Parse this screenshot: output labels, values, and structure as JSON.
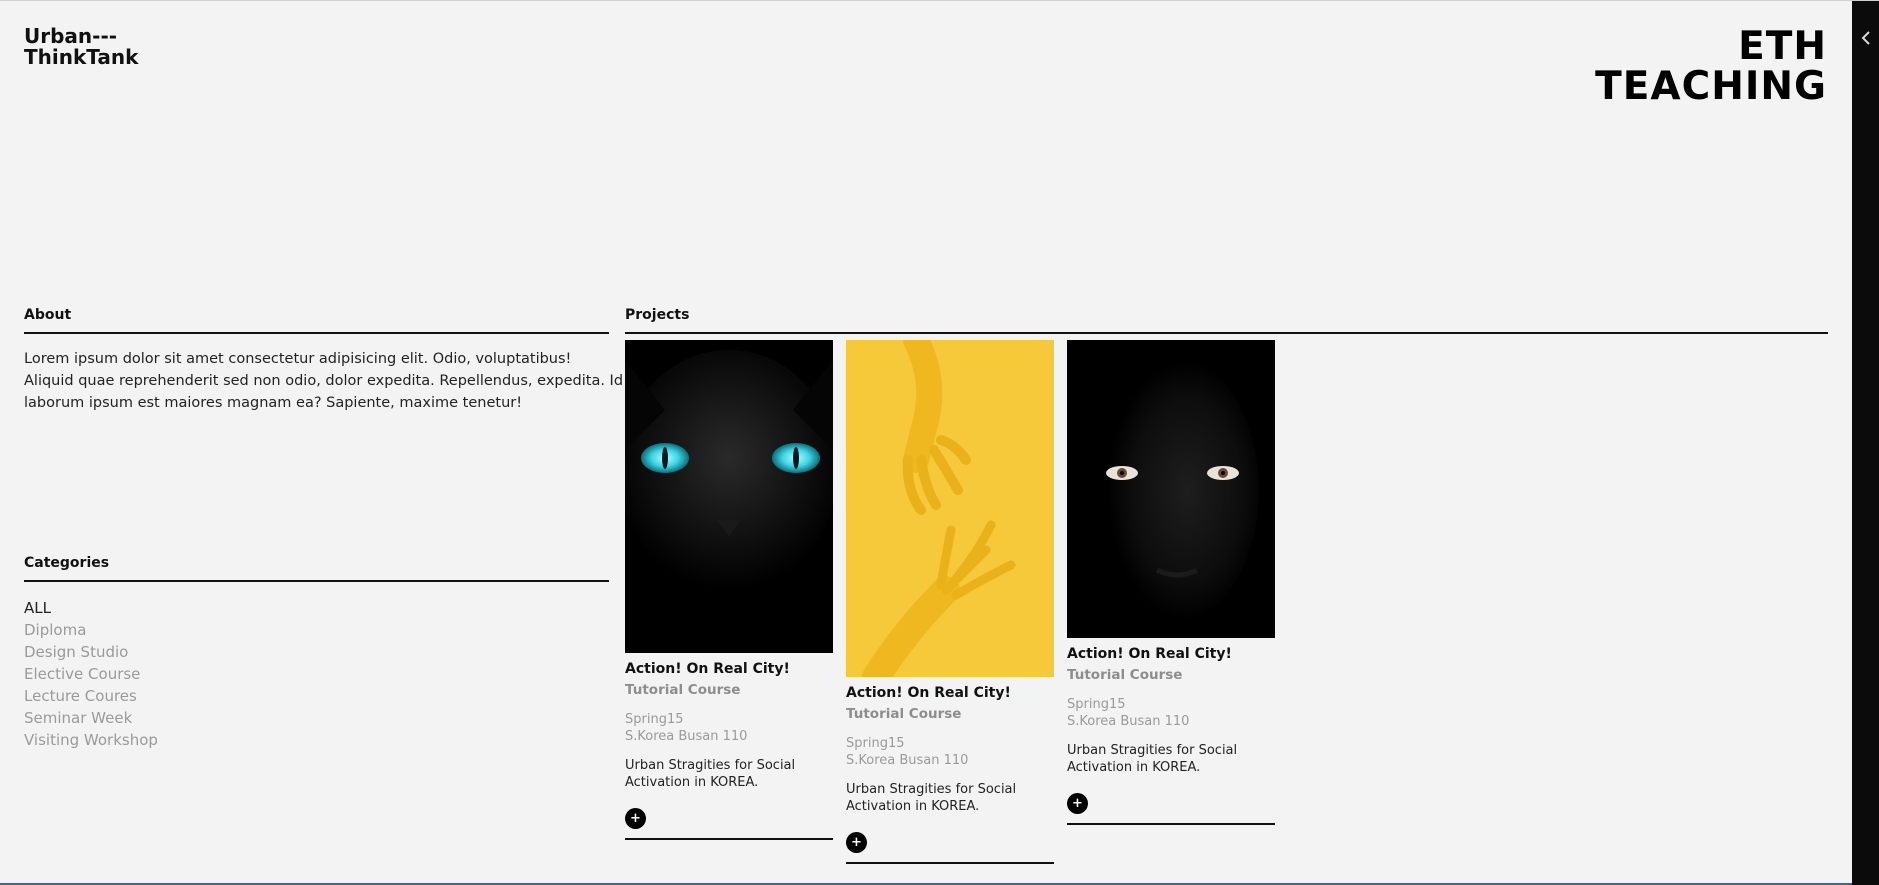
{
  "brand": {
    "line1": "Urban---",
    "line2": "ThinkTank"
  },
  "hero": {
    "line1": "ETH",
    "line2": "TEACHING"
  },
  "about": {
    "heading": "About",
    "text": "Lorem ipsum dolor sit amet consectetur adipisicing elit. Odio, voluptatibus! Aliquid quae reprehenderit sed non odio, dolor expedita. Repellendus, expedita. Id laborum ipsum est maiores magnam ea? Sapiente, maxime tenetur!"
  },
  "categories": {
    "heading": "Categories",
    "items": [
      {
        "label": "ALL",
        "active": true
      },
      {
        "label": "Diploma",
        "active": false
      },
      {
        "label": "Design Studio",
        "active": false
      },
      {
        "label": "Elective Course",
        "active": false
      },
      {
        "label": "Lecture Coures",
        "active": false
      },
      {
        "label": "Seminar Week",
        "active": false
      },
      {
        "label": "Visiting Workshop",
        "active": false
      }
    ]
  },
  "projects": {
    "heading": "Projects",
    "cards": [
      {
        "image": "black-cat-blue-eyes",
        "title": "Action! On Real City!",
        "subtitle": "Tutorial Course",
        "term": "Spring15",
        "location": "S.Korea Busan 110",
        "description": "Urban Stragities for Social Activation in KOREA.",
        "button": "+"
      },
      {
        "image": "yellow-hands",
        "title": "Action! On Real City!",
        "subtitle": "Tutorial Course",
        "term": "Spring15",
        "location": "S.Korea Busan 110",
        "description": "Urban Stragities for Social Activation in KOREA.",
        "button": "+"
      },
      {
        "image": "dark-portrait",
        "title": "Action! On Real City!",
        "subtitle": "Tutorial Course",
        "term": "Spring15",
        "location": "S.Korea Busan 110",
        "description": "Urban Stragities for Social Activation in KOREA.",
        "button": "+"
      }
    ]
  },
  "rail": {
    "icon": "chevron-left-icon"
  },
  "colors": {
    "background": "#f3f3f3",
    "text": "#111111",
    "muted": "#9a9a9a",
    "rail": "#0b0b0b",
    "cat_eye": "#3fd6e6",
    "yellow": "#f5c93a"
  }
}
